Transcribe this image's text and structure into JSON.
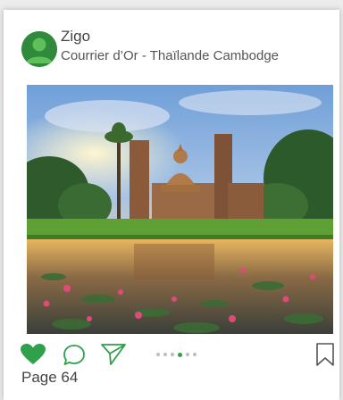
{
  "post": {
    "username": "Zigo",
    "subtitle": "Courrier d’Or - Thaïlande Cambodge",
    "page_label": "Page 64",
    "carousel": {
      "count": 5,
      "active_index": 3
    }
  },
  "icons": {
    "avatar": "user-avatar",
    "like": "heart-icon",
    "comment": "comment-bubble-icon",
    "share": "send-icon",
    "save": "bookmark-icon"
  },
  "colors": {
    "accent": "#2fa14a",
    "avatar": "#2f8a3c",
    "text": "#444444"
  }
}
